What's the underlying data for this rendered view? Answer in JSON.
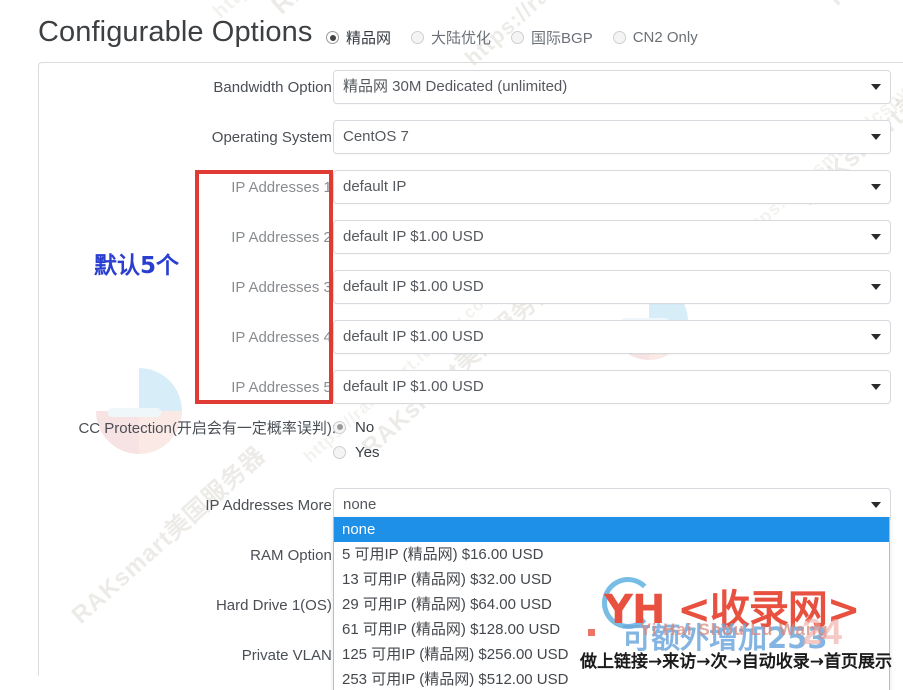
{
  "page": {
    "title": "Configurable Options"
  },
  "network_radios": [
    {
      "label": "精品网",
      "selected": true,
      "enabled": true
    },
    {
      "label": "大陆优化",
      "selected": false,
      "enabled": false
    },
    {
      "label": "国际BGP",
      "selected": false,
      "enabled": false
    },
    {
      "label": "CN2 Only",
      "selected": false,
      "enabled": false
    }
  ],
  "rows": [
    {
      "label": "Bandwidth Option:",
      "value": "精品网 30M Dedicated (unlimited)",
      "type": "select"
    },
    {
      "label": "Operating System:",
      "value": "CentOS 7",
      "type": "select"
    },
    {
      "label": "IP Addresses 1:",
      "value": "default IP",
      "type": "select"
    },
    {
      "label": "IP Addresses 2:",
      "value": "default IP $1.00 USD",
      "type": "select"
    },
    {
      "label": "IP Addresses 3:",
      "value": "default IP $1.00 USD",
      "type": "select"
    },
    {
      "label": "IP Addresses 4:",
      "value": "default IP $1.00 USD",
      "type": "select"
    },
    {
      "label": "IP Addresses 5:",
      "value": "default IP $1.00 USD",
      "type": "select"
    },
    {
      "label": "CC Protection(开启会有一定概率误判):",
      "value": "No",
      "type": "radio"
    },
    {
      "label": "IP Addresses More:",
      "value": "none",
      "type": "select-open"
    },
    {
      "label": "RAM Option:",
      "value": "",
      "type": "select"
    },
    {
      "label": "Hard Drive 1(OS):",
      "value": "",
      "type": "select"
    },
    {
      "label": "Private VLAN:",
      "value": "",
      "type": "select"
    }
  ],
  "cc_protection": {
    "options": [
      {
        "label": "No",
        "selected": true
      },
      {
        "label": "Yes",
        "selected": false
      }
    ]
  },
  "ip_more_dropdown": {
    "selected_value": "none",
    "options": [
      {
        "label": "none",
        "highlighted": true
      },
      {
        "label": "5 可用IP (精品网) $16.00 USD",
        "highlighted": false
      },
      {
        "label": "13 可用IP (精品网) $32.00 USD",
        "highlighted": false
      },
      {
        "label": "29 可用IP (精品网) $64.00 USD",
        "highlighted": false
      },
      {
        "label": "61 可用IP (精品网) $128.00 USD",
        "highlighted": false
      },
      {
        "label": "125 可用IP (精品网) $256.00 USD",
        "highlighted": false
      },
      {
        "label": "253 可用IP (精品网) $512.00 USD",
        "highlighted": false
      }
    ]
  },
  "annotation": {
    "note_text": "默认5个",
    "box_color": "#e03a34",
    "note_color": "#2a3fd0"
  },
  "watermarks": {
    "background": [
      "RAKsmart美国服务器",
      "https://raksmart美国服",
      "https://raksmart.idcspy.com",
      "RAKsmart美国服务器"
    ],
    "overlay": {
      "brand": "YH <收录网>",
      "brand_pinyin": "Yi Hai Shou Lu Wang",
      "blue_text": "可额外增加253",
      "badge": "24",
      "badge_sub": "小时在线\n客服咨询",
      "tagline": "做上链接→来访→次→自动收录→首页展示"
    }
  },
  "colors": {
    "accent_blue": "#1e90e8",
    "annotation_red": "#e03a34",
    "annotation_blue": "#2a3fd0",
    "brand_red": "#e8503f"
  }
}
